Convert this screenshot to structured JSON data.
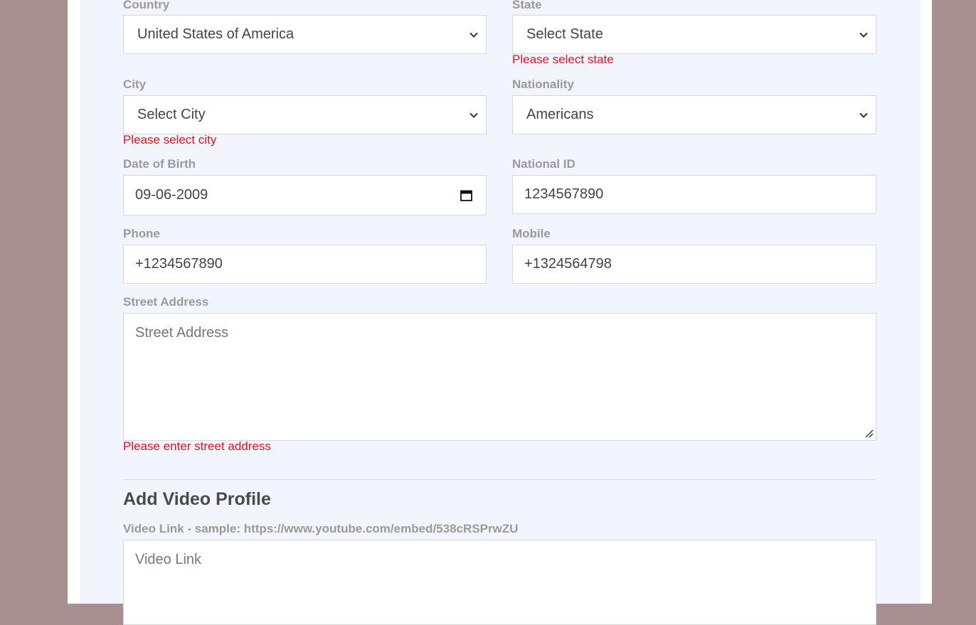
{
  "form": {
    "country": {
      "label": "Country",
      "value": "United States of America"
    },
    "state": {
      "label": "State",
      "value": "Select State",
      "error": "Please select state"
    },
    "city": {
      "label": "City",
      "value": "Select City",
      "error": "Please select city"
    },
    "nationality": {
      "label": "Nationality",
      "value": "Americans"
    },
    "dob": {
      "label": "Date of Birth",
      "value": "09-06-2009"
    },
    "national_id": {
      "label": "National ID",
      "value": "1234567890"
    },
    "phone": {
      "label": "Phone",
      "value": "+1234567890"
    },
    "mobile": {
      "label": "Mobile",
      "value": "+1324564798"
    },
    "street_address": {
      "label": "Street Address",
      "placeholder": "Street Address",
      "error": "Please enter street address"
    }
  },
  "video_section": {
    "title": "Add Video Profile",
    "video_link": {
      "label": "Video Link - sample: https://www.youtube.com/embed/538cRSPrwZU",
      "placeholder": "Video Link"
    }
  },
  "colors": {
    "background": "#a89090",
    "form_background": "#f2f5fd",
    "error": "#e0101f",
    "label": "#9a9a9a"
  },
  "icons": {
    "select_arrow": "chevron-down-icon",
    "date_picker": "calendar-icon",
    "textarea_resize": "resize-grip-icon"
  }
}
